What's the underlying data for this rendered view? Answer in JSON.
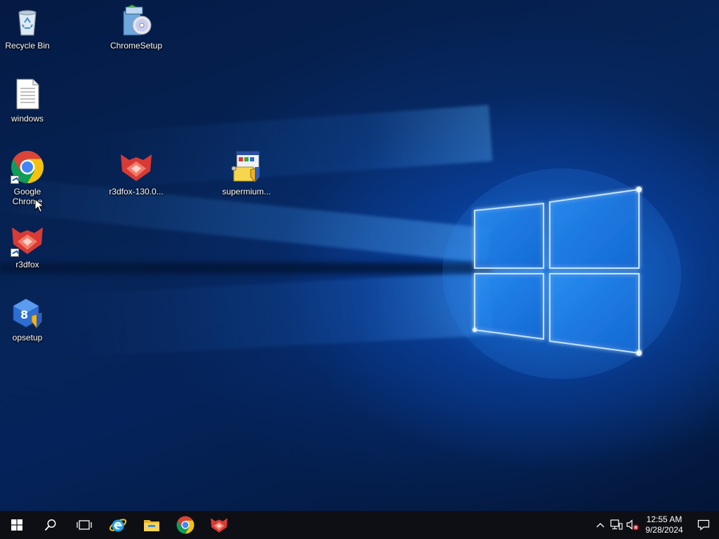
{
  "desktop": {
    "icons": [
      {
        "label": "Recycle Bin",
        "icon": "recycle-bin-icon"
      },
      {
        "label": "ChromeSetup",
        "icon": "installer-disc-icon"
      },
      {
        "label": "windows",
        "icon": "text-document-icon"
      },
      {
        "label": "Google Chrome",
        "icon": "chrome-icon"
      },
      {
        "label": "r3dfox-130.0...",
        "icon": "r3dfox-icon"
      },
      {
        "label": "supermium...",
        "icon": "setup-installer-icon"
      },
      {
        "label": "r3dfox",
        "icon": "r3dfox-icon"
      },
      {
        "label": "opsetup",
        "icon": "opsetup-shield-icon"
      }
    ]
  },
  "taskbar": {
    "start_icon": "windows-start-icon",
    "search_icon": "search-icon",
    "task_view_icon": "task-view-icon",
    "pinned": [
      {
        "name": "Internet Explorer",
        "icon": "internet-explorer-icon"
      },
      {
        "name": "File Explorer",
        "icon": "file-explorer-icon"
      },
      {
        "name": "Google Chrome",
        "icon": "chrome-icon"
      },
      {
        "name": "r3dfox",
        "icon": "r3dfox-icon"
      }
    ],
    "tray": {
      "chevron_icon": "chevron-up-icon",
      "network_icon": "network-icon",
      "volume_icon": "volume-muted-icon",
      "time": "12:55 AM",
      "date": "9/28/2024",
      "notification_icon": "action-center-icon"
    }
  },
  "colors": {
    "taskbar_bg": "#0d0f14",
    "wallpaper_accent": "#1a7fe6",
    "chrome_red": "#db4437",
    "chrome_yellow": "#f4c20d",
    "chrome_green": "#0f9d58",
    "chrome_blue": "#4285f4",
    "r3dfox_red": "#d83a36"
  }
}
